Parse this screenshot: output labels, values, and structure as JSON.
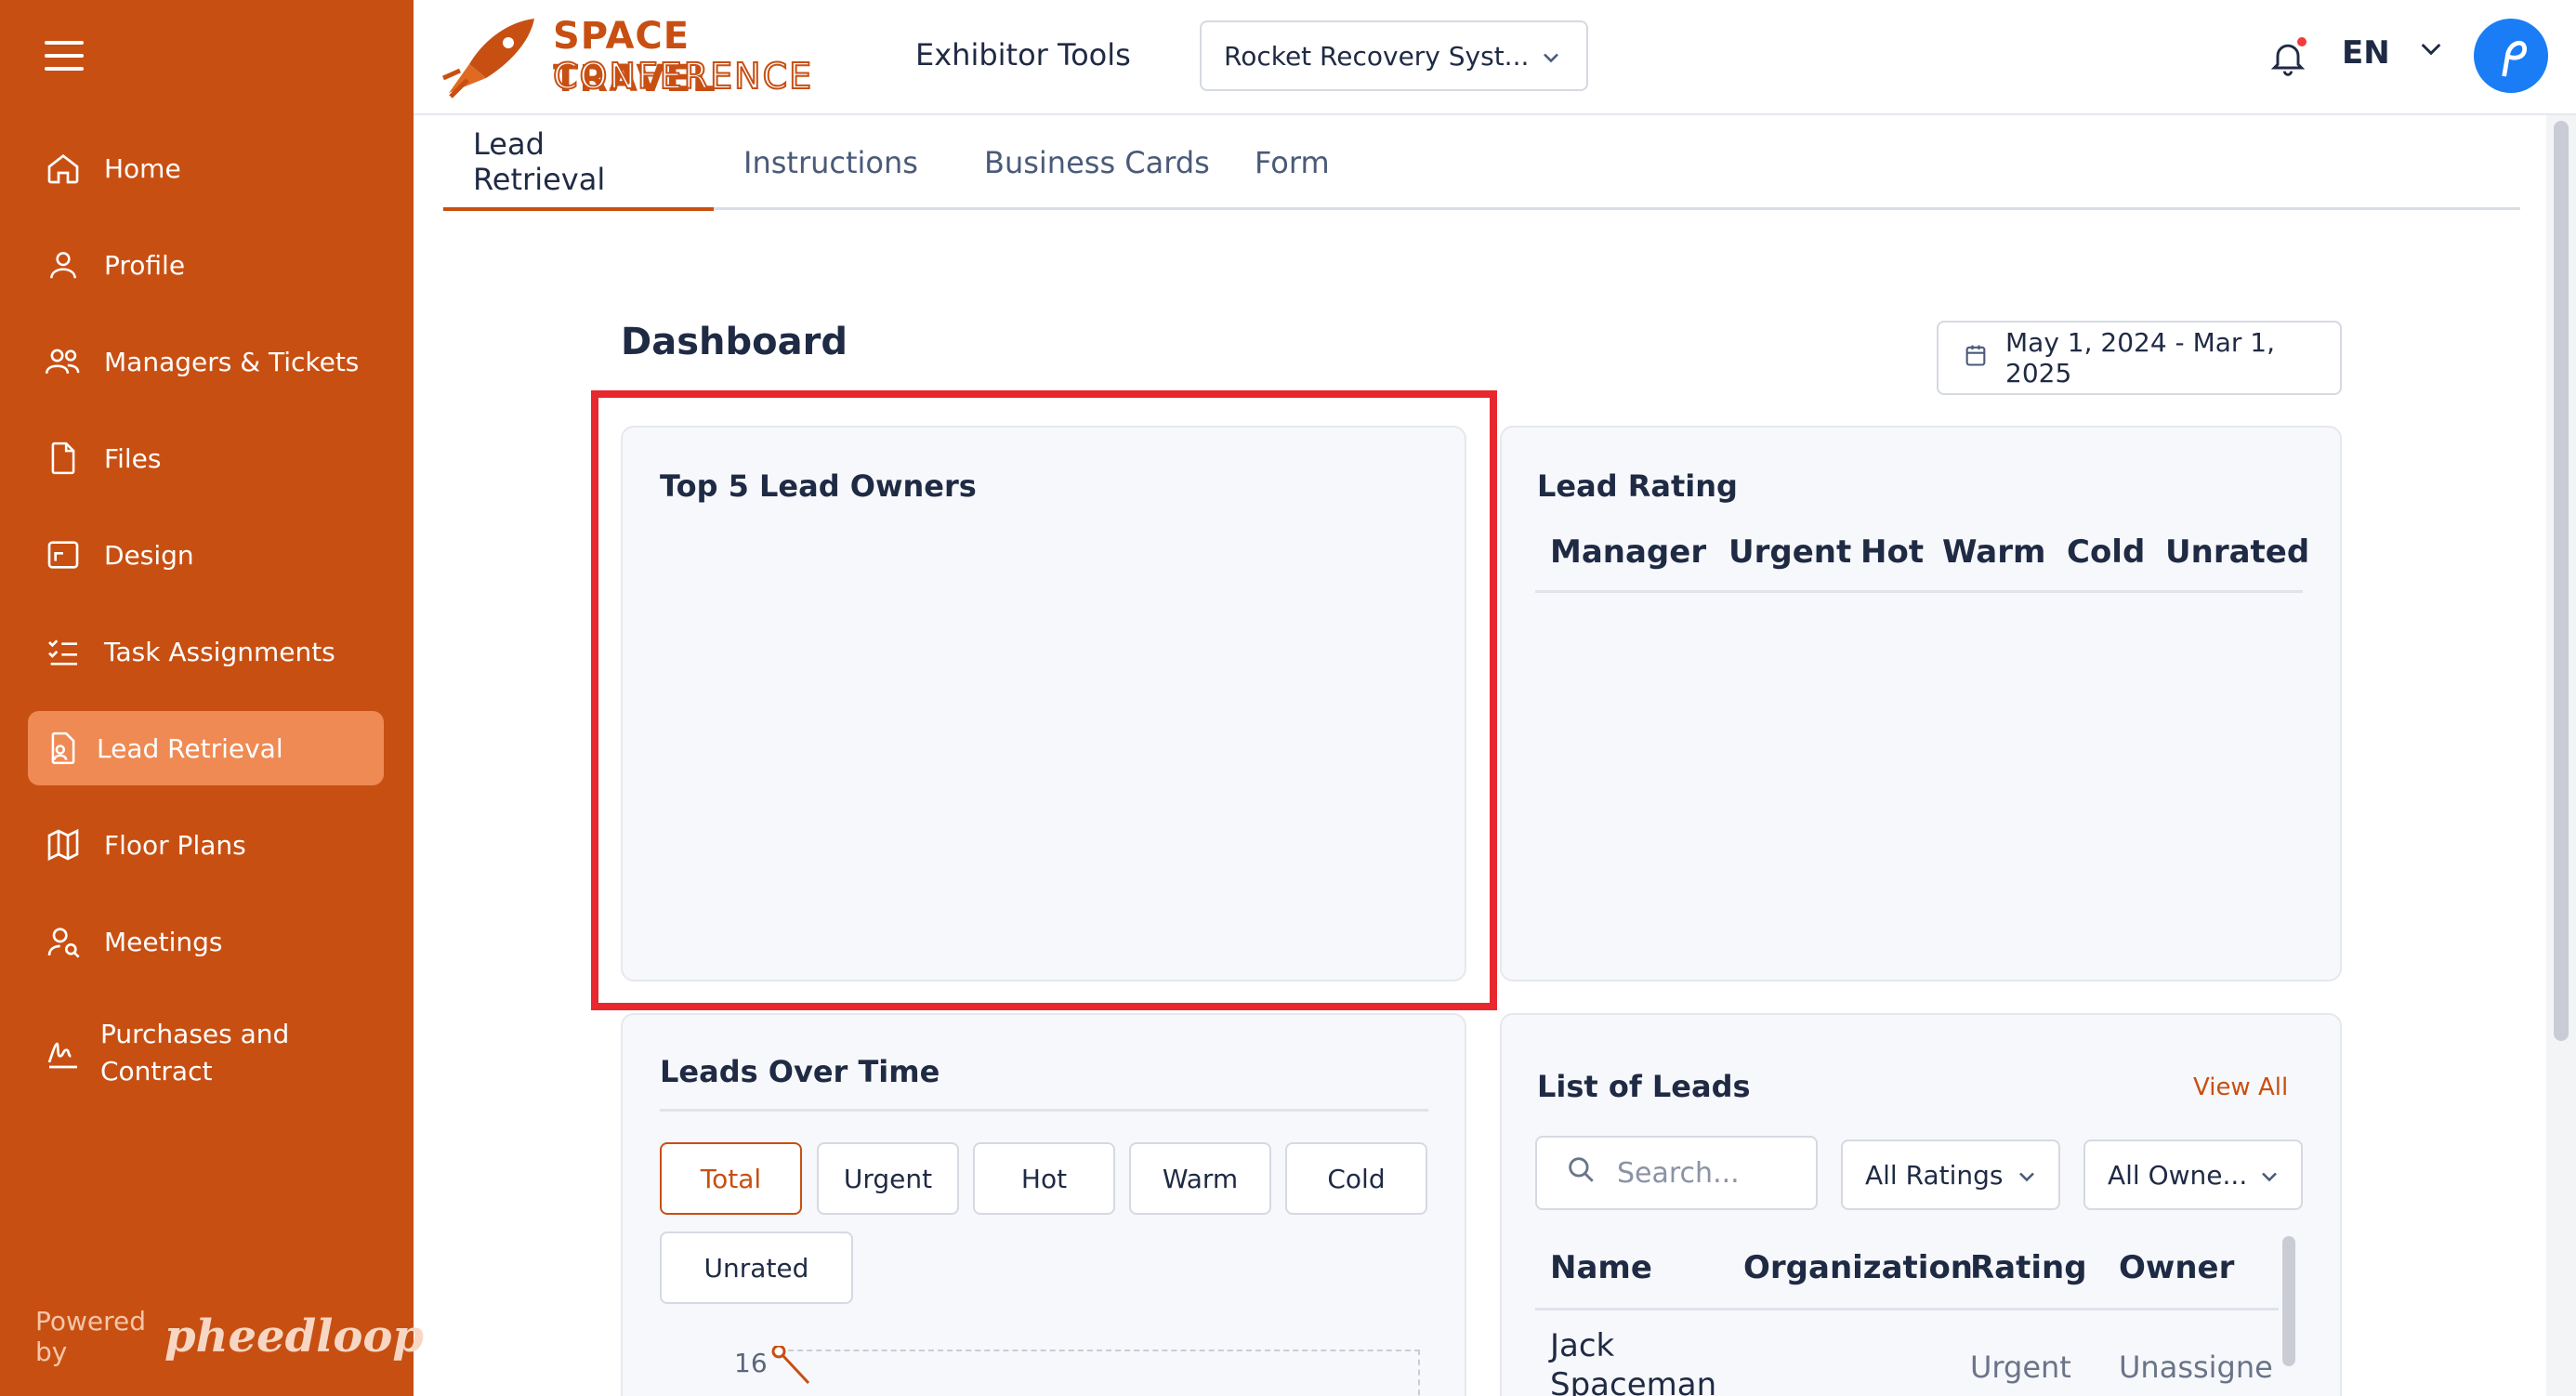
{
  "sidebar": {
    "items": [
      {
        "label": "Home",
        "icon": "home-icon"
      },
      {
        "label": "Profile",
        "icon": "user-icon"
      },
      {
        "label": "Managers & Tickets",
        "icon": "users-icon"
      },
      {
        "label": "Files",
        "icon": "file-icon"
      },
      {
        "label": "Design",
        "icon": "design-icon"
      },
      {
        "label": "Task Assignments",
        "icon": "checklist-icon"
      },
      {
        "label": "Lead Retrieval",
        "icon": "lead-icon",
        "active": true
      },
      {
        "label": "Floor Plans",
        "icon": "map-icon"
      },
      {
        "label": "Meetings",
        "icon": "meetings-icon"
      },
      {
        "label": "Purchases and Contract",
        "icon": "signature-icon"
      }
    ],
    "powered_by": "Powered by",
    "powered_brand": "pheedloop"
  },
  "header": {
    "logo_line1": "SPACE TRAVEL",
    "logo_line2": "CONFERENCE",
    "app_title": "Exhibitor Tools",
    "event_select": "Rocket Recovery Syst...",
    "language": "EN"
  },
  "tabs": [
    "Lead Retrieval",
    "Instructions",
    "Business Cards",
    "Form"
  ],
  "dashboard": {
    "title": "Dashboard",
    "date_range": "May 1, 2024 - Mar 1, 2025"
  },
  "top_owners": {
    "title": "Top 5 Lead Owners"
  },
  "lead_rating": {
    "title": "Lead Rating",
    "headers": [
      "Manager",
      "Urgent",
      "Hot",
      "Warm",
      "Cold",
      "Unrated"
    ]
  },
  "leads_over_time": {
    "title": "Leads Over Time",
    "filters": [
      "Total",
      "Urgent",
      "Hot",
      "Warm",
      "Cold",
      "Unrated"
    ],
    "active_filter": "Total",
    "y_tick": "16"
  },
  "list_of_leads": {
    "title": "List of Leads",
    "view_all": "View All",
    "search_placeholder": "Search...",
    "rating_filter": "All Ratings",
    "owner_filter": "All Owne...",
    "headers": [
      "Name",
      "Organization",
      "Rating",
      "Owner"
    ],
    "rows": [
      {
        "name_line1": "Jack",
        "name_line2": "Spaceman",
        "organization": "",
        "rating": "Urgent",
        "owner": "Unassigne"
      }
    ]
  },
  "colors": {
    "brand": "#c84f12",
    "sidebar_active": "#ef8a54",
    "highlight": "#e8282e",
    "avatar": "#1a7df5"
  }
}
